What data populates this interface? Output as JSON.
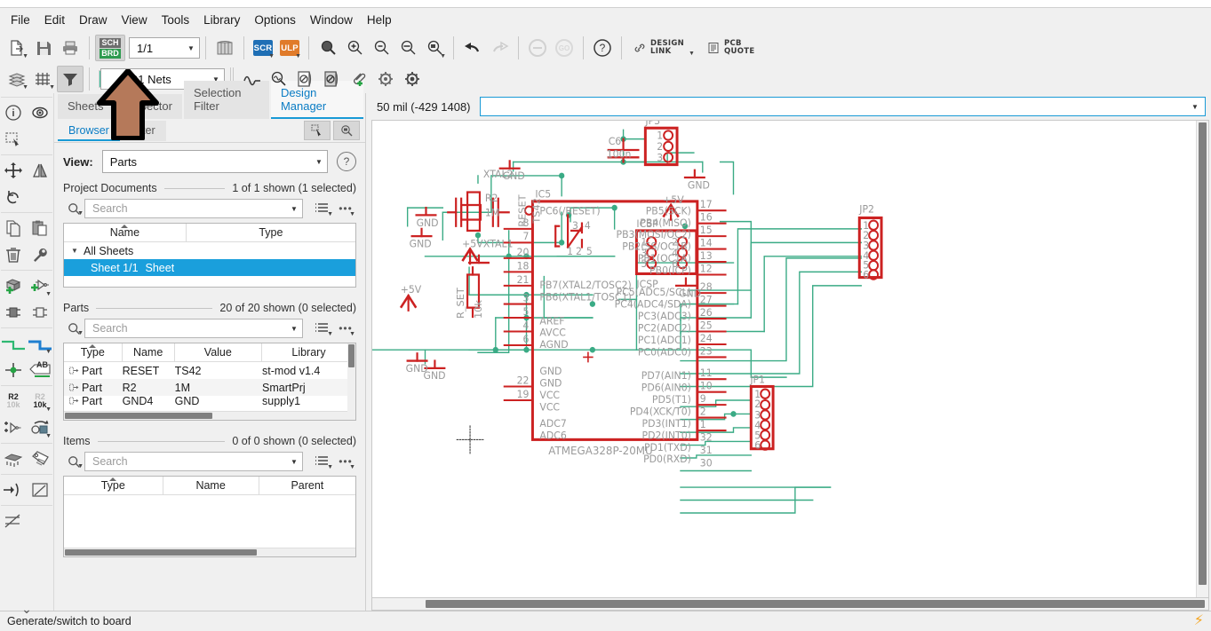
{
  "menu": {
    "items": [
      "File",
      "Edit",
      "Draw",
      "View",
      "Tools",
      "Library",
      "Options",
      "Window",
      "Help"
    ]
  },
  "toolbar_main": {
    "buttons": [
      {
        "name": "export-button",
        "icon": "export-icon",
        "label": "Export"
      },
      {
        "name": "save-button",
        "icon": "save-icon",
        "label": "Save"
      },
      {
        "name": "print-button",
        "icon": "print-icon",
        "label": "Print"
      },
      {
        "name": "switch-to-board-button",
        "icon": "sch-brd-icon",
        "label": "SCH/BRD"
      },
      {
        "name": "library-manager-button",
        "icon": "books-icon",
        "label": "Library Manager"
      },
      {
        "name": "run-script-button",
        "icon": "scr-icon",
        "label": "SCR"
      },
      {
        "name": "run-ulp-button",
        "icon": "ulp-icon",
        "label": "ULP"
      },
      {
        "name": "zoom-fit-button",
        "icon": "zoom-fit-icon",
        "label": "Zoom to fit"
      },
      {
        "name": "zoom-in-button",
        "icon": "zoom-in-icon",
        "label": "Zoom in"
      },
      {
        "name": "zoom-out-button",
        "icon": "zoom-out-icon",
        "label": "Zoom out"
      },
      {
        "name": "zoom-redraw-button",
        "icon": "zoom-redraw-icon",
        "label": "Redraw"
      },
      {
        "name": "zoom-select-button",
        "icon": "zoom-select-icon",
        "label": "Zoom select"
      },
      {
        "name": "undo-button",
        "icon": "undo-arrow-icon",
        "label": "Undo"
      },
      {
        "name": "redo-button",
        "icon": "redo-arrow-icon",
        "label": "Redo"
      },
      {
        "name": "stop-button",
        "icon": "stop-icon",
        "label": "Stop"
      },
      {
        "name": "go-button",
        "icon": "go-icon",
        "label": "GO"
      },
      {
        "name": "help-button",
        "icon": "question-icon",
        "label": "Help"
      }
    ],
    "page_select": {
      "value": "1/1",
      "name": "sheet-page-select"
    },
    "design_link": {
      "line1": "DESIGN",
      "line2": "LINK"
    },
    "pcb_quote": {
      "line1": "PCB",
      "line2": "QUOTE"
    },
    "go_label": "GO"
  },
  "toolbar_secondary": {
    "buttons": [
      {
        "name": "layers-button",
        "icon": "layers-icon"
      },
      {
        "name": "grid-button",
        "icon": "grid-icon"
      },
      {
        "name": "display-filter-button",
        "icon": "funnel-icon"
      },
      {
        "name": "net-classes-button",
        "icon": "wave-icon"
      },
      {
        "name": "erc-button",
        "icon": "magnifier-wave-icon"
      },
      {
        "name": "sheet-props-button",
        "icon": "sheet-no-icon"
      },
      {
        "name": "sheet-props2-button",
        "icon": "sheet-dual-icon"
      },
      {
        "name": "attach-button",
        "icon": "paperclip-plus-icon"
      },
      {
        "name": "gear-a-button",
        "icon": "gear-light-icon"
      },
      {
        "name": "gear-b-button",
        "icon": "gear-dark-icon"
      }
    ],
    "nets_select": {
      "value": "91 Nets",
      "swatch_color": "#3dc49f",
      "name": "nets-select"
    }
  },
  "left_rail": {
    "tools": [
      {
        "name": "info-tool",
        "icon": "info-icon",
        "label": "Info"
      },
      {
        "name": "show-tool",
        "icon": "eye-icon",
        "label": "Show"
      },
      {
        "name": "group-tool",
        "icon": "marquee-select-icon",
        "label": "Group"
      },
      {
        "name": "move-tool",
        "icon": "move-arrows-icon",
        "label": "Move"
      },
      {
        "name": "mirror-tool",
        "icon": "mirror-icon",
        "label": "Mirror"
      },
      {
        "name": "rotate-tool",
        "icon": "rotate-icon",
        "label": "Rotate"
      },
      {
        "name": "copy-tool",
        "icon": "copy-icon",
        "label": "Copy"
      },
      {
        "name": "paste-tool",
        "icon": "paste-icon",
        "label": "Paste"
      },
      {
        "name": "delete-tool",
        "icon": "trash-icon",
        "label": "Delete"
      },
      {
        "name": "change-tool",
        "icon": "wrench-icon",
        "label": "Change"
      },
      {
        "name": "add-part-tool",
        "icon": "add-part-icon",
        "label": "Add Part"
      },
      {
        "name": "add-pin-tool",
        "icon": "add-gate-icon",
        "label": "Add"
      },
      {
        "name": "pinswap-tool",
        "icon": "pinswap-icon",
        "label": "Pinswap"
      },
      {
        "name": "gateswap-tool",
        "icon": "gateswap-icon",
        "label": "Gateswap"
      },
      {
        "name": "net-tool",
        "icon": "net-green-icon",
        "label": "Net"
      },
      {
        "name": "bus-tool",
        "icon": "bus-blue-icon",
        "label": "Bus"
      },
      {
        "name": "junction-tool",
        "icon": "junction-icon",
        "label": "Junction"
      },
      {
        "name": "label-tool",
        "icon": "label-ab-icon",
        "label": "Label"
      },
      {
        "name": "name-tool",
        "icon": "name-r2-icon",
        "label": "Name"
      },
      {
        "name": "value-tool",
        "icon": "value-r2-icon",
        "label": "Value"
      },
      {
        "name": "invoke-tool",
        "icon": "invoke-gate-icon",
        "label": "Invoke"
      },
      {
        "name": "replace-tool",
        "icon": "replace-icon",
        "label": "Replace"
      },
      {
        "name": "device-tool",
        "icon": "dip-chip-icon",
        "label": "Device"
      },
      {
        "name": "attribute-tool",
        "icon": "tag-icon",
        "label": "Attribute"
      },
      {
        "name": "pin-tool",
        "icon": "pin-arrow-icon",
        "label": "Pin"
      },
      {
        "name": "polygon-tool",
        "icon": "polygon-icon",
        "label": "Polygon"
      },
      {
        "name": "dimension-tool",
        "icon": "dimension-icon",
        "label": "Dimension"
      },
      {
        "name": "more-tools",
        "icon": "chevron-double-down-icon",
        "label": "More"
      }
    ],
    "name_badge": {
      "top": "R2",
      "bottom": "10k"
    }
  },
  "panel": {
    "tabs": [
      {
        "label": "Sheets",
        "name": "tab-sheets",
        "selected": false
      },
      {
        "label": "Inspector",
        "name": "tab-inspector",
        "selected": false
      },
      {
        "label": "Selection Filter",
        "name": "tab-selection-filter",
        "selected": false
      },
      {
        "label": "Design Manager",
        "name": "tab-design-manager",
        "selected": true
      }
    ],
    "subtabs": [
      {
        "label": "Browser",
        "name": "subtab-browser",
        "selected": true
      },
      {
        "label": "Filter",
        "name": "subtab-filter",
        "selected": false
      }
    ],
    "subtools": [
      {
        "name": "pick-cursor-button",
        "icon": "cursor-pick-icon"
      },
      {
        "name": "zoom-to-selection-button",
        "icon": "magnifier-select-icon"
      }
    ],
    "view": {
      "label": "View:",
      "value": "Parts",
      "name": "view-select"
    },
    "project_documents": {
      "title": "Project Documents",
      "count": "1 of 1 shown (1 selected)",
      "search_placeholder": "Search",
      "search_value": "",
      "columns": [
        "Name",
        "Type"
      ],
      "rows": [
        {
          "indent": 0,
          "expander": "▼",
          "name": "All Sheets",
          "type": "",
          "selected": false
        },
        {
          "indent": 1,
          "expander": "",
          "name": "Sheet 1/1",
          "type": "Sheet",
          "selected": true
        }
      ]
    },
    "parts": {
      "title": "Parts",
      "count": "20 of 20 shown (0 selected)",
      "search_placeholder": "Search",
      "search_value": "",
      "columns": [
        "Type",
        "Name",
        "Value",
        "Library"
      ],
      "rows": [
        {
          "type": "Part",
          "name": "RESET",
          "value": "TS42",
          "library": "st-mod v1.4"
        },
        {
          "type": "Part",
          "name": "R2",
          "value": "1M",
          "library": "SmartPrj"
        },
        {
          "type": "Part",
          "name": "GND4",
          "value": "GND",
          "library": "supply1"
        }
      ]
    },
    "items": {
      "title": "Items",
      "count": "0 of 0 shown (0 selected)",
      "search_placeholder": "Search",
      "search_value": "",
      "columns": [
        "Type",
        "Name",
        "Parent"
      ],
      "rows": []
    }
  },
  "canvas": {
    "coordinate_text": "50 mil (-429 1408)",
    "command_value": "",
    "command_placeholder": ""
  },
  "statusbar": {
    "message": "Generate/switch to board",
    "bolt_icon": "lightning-icon"
  },
  "colors": {
    "accent_blue": "#199ad6",
    "selection_blue": "#1a9fdc",
    "net_green": "#3dc49f",
    "part_red": "#cc2222",
    "pin_gray": "#9a9a9a",
    "arrow_brown": "#b5795a",
    "scr_blue": "#1f6fb5",
    "ulp_orange": "#e07b2a",
    "sch_gray": "#6e6e6e",
    "brd_green": "#2e9b4f",
    "bolt_orange": "#f5a623"
  },
  "schematic": {
    "title": "ATMEGA328P-20MU",
    "ic_name": "IC5",
    "ic_left_pins": [
      {
        "num": "",
        "label": "PC6(/RESET)"
      },
      {
        "num": "8",
        "label": "PB7(XTAL2/TOSC2)"
      },
      {
        "num": "7",
        "label": "PB6(XTAL1/TOSC1)"
      },
      {
        "num": "20",
        "label": "AREF"
      },
      {
        "num": "18",
        "label": "AVCC"
      },
      {
        "num": "21",
        "label": "AGND"
      },
      {
        "num": "3",
        "label": "GND"
      },
      {
        "num": "5",
        "label": "GND"
      },
      {
        "num": "4",
        "label": "VCC"
      },
      {
        "num": "6",
        "label": "VCC"
      },
      {
        "num": "22",
        "label": "ADC7"
      },
      {
        "num": "19",
        "label": "ADC6"
      }
    ],
    "ic_right_pins": [
      {
        "num": "17",
        "label": "PB5(SCK)"
      },
      {
        "num": "16",
        "label": "PB4(MISO)"
      },
      {
        "num": "15",
        "label": "PB3(MOSI/OC2)"
      },
      {
        "num": "14",
        "label": "PB2(SS/OC1B)"
      },
      {
        "num": "13",
        "label": "PB1(OC1A)"
      },
      {
        "num": "12",
        "label": "PB0(ICP)"
      },
      {
        "num": "28",
        "label": "PC5(ADC5/SCL)"
      },
      {
        "num": "27",
        "label": "PC4(ADC4/SDA)"
      },
      {
        "num": "26",
        "label": "PC3(ADC3)"
      },
      {
        "num": "25",
        "label": "PC2(ADC2)"
      },
      {
        "num": "24",
        "label": "PC1(ADC1)"
      },
      {
        "num": "23",
        "label": "PC0(ADC0)"
      },
      {
        "num": "11",
        "label": "PD7(AIN1)"
      },
      {
        "num": "10",
        "label": "PD6(AIN0)"
      },
      {
        "num": "9",
        "label": "PD5(T1)"
      },
      {
        "num": "2",
        "label": "PD4(XCK/T0)"
      },
      {
        "num": "1",
        "label": "PD3(INT1)"
      },
      {
        "num": "32",
        "label": "PD2(INT0)"
      },
      {
        "num": "31",
        "label": "PD1(TXD)"
      },
      {
        "num": "30",
        "label": "PD0(RXD)"
      }
    ],
    "connectors": [
      {
        "name": "JP3",
        "pins": [
          "1",
          "2",
          "3"
        ],
        "layout": "single"
      },
      {
        "name": "ICSP",
        "pins": [
          "1",
          "2",
          "3",
          "4",
          "5",
          "6"
        ],
        "layout": "double"
      },
      {
        "name": "JP2",
        "pins": [
          "1",
          "2",
          "3",
          "4",
          "5",
          "6"
        ],
        "layout": "single"
      },
      {
        "name": "JP1",
        "pins": [
          "1",
          "2",
          "3",
          "4",
          "5",
          "6"
        ],
        "layout": "single"
      }
    ],
    "labels": [
      "GND",
      "C6",
      "100n",
      "JP3",
      "GND",
      "RESET",
      "TS42",
      "GND",
      "ICSP",
      "+5V",
      "ICSP",
      "GND",
      "+5V",
      "R_SET",
      "10k",
      "IC5",
      "XTAL2",
      "XTAL1",
      "R2",
      "1M",
      "GND",
      "+5V",
      "GND",
      "GND",
      "JP1",
      "JP2",
      "ATMEGA328P-20MU"
    ]
  }
}
